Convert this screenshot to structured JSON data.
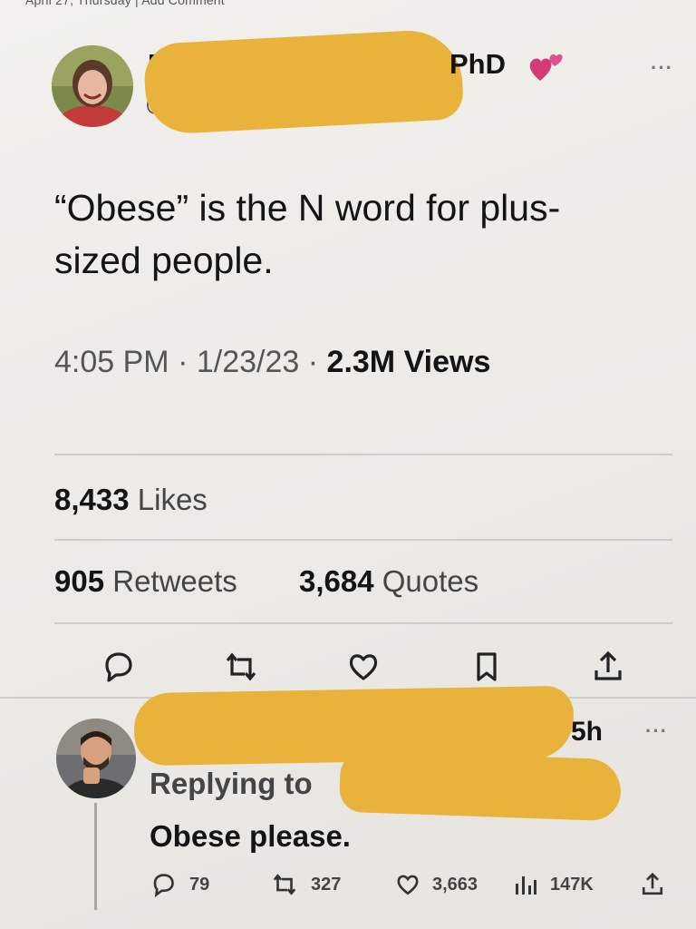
{
  "topbar": {
    "text": "April 27, Thursday | Add Comment"
  },
  "tweet": {
    "author_prefix": "Dr.",
    "author_suffix": "PhD",
    "handle_initial": "@",
    "text": "“Obese” is the N word for plus-sized people.",
    "time": "4:05 PM",
    "date": "1/23/23",
    "views_count": "2.3M",
    "views_label": "Views",
    "separator": "·",
    "stats": {
      "likes_count": "8,433",
      "likes_label": "Likes",
      "retweets_count": "905",
      "retweets_label": "Retweets",
      "quotes_count": "3,684",
      "quotes_label": "Quotes"
    },
    "actions": [
      "reply-icon",
      "retweet-icon",
      "like-icon",
      "bookmark-icon",
      "share-icon"
    ]
  },
  "reply": {
    "time": "5h",
    "replying_label": "Replying to",
    "text": "Obese please.",
    "counts": {
      "replies": "79",
      "retweets": "327",
      "likes": "3,663",
      "views": "147K"
    }
  },
  "colors": {
    "redaction": "#e9b23a",
    "text": "#141414",
    "secondary": "#555555",
    "heart": "#d23b78"
  }
}
